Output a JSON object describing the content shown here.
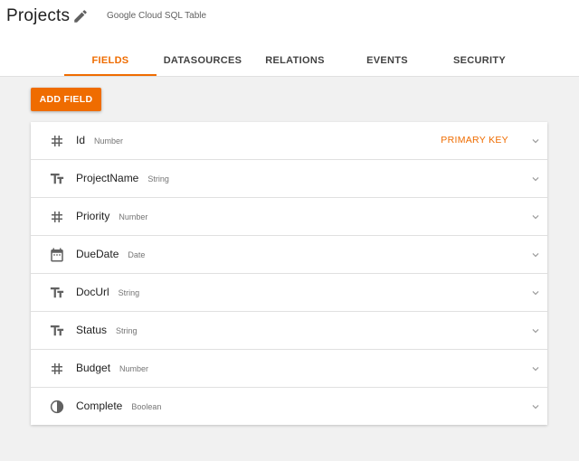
{
  "header": {
    "title": "Projects",
    "subtitle": "Google Cloud SQL Table"
  },
  "tabs": [
    {
      "label": "FIELDS",
      "active": true
    },
    {
      "label": "DATASOURCES",
      "active": false
    },
    {
      "label": "RELATIONS",
      "active": false
    },
    {
      "label": "EVENTS",
      "active": false
    },
    {
      "label": "SECURITY",
      "active": false
    }
  ],
  "add_field_label": "ADD FIELD",
  "fields": [
    {
      "name": "Id",
      "type": "Number",
      "icon": "hash-icon",
      "badge": "PRIMARY KEY"
    },
    {
      "name": "ProjectName",
      "type": "String",
      "icon": "text-icon",
      "badge": ""
    },
    {
      "name": "Priority",
      "type": "Number",
      "icon": "hash-icon",
      "badge": ""
    },
    {
      "name": "DueDate",
      "type": "Date",
      "icon": "calendar-icon",
      "badge": ""
    },
    {
      "name": "DocUrl",
      "type": "String",
      "icon": "text-icon",
      "badge": ""
    },
    {
      "name": "Status",
      "type": "String",
      "icon": "text-icon",
      "badge": ""
    },
    {
      "name": "Budget",
      "type": "Number",
      "icon": "hash-icon",
      "badge": ""
    },
    {
      "name": "Complete",
      "type": "Boolean",
      "icon": "contrast-icon",
      "badge": ""
    }
  ],
  "colors": {
    "accent": "#ef6c00",
    "background": "#f1f1f1"
  }
}
